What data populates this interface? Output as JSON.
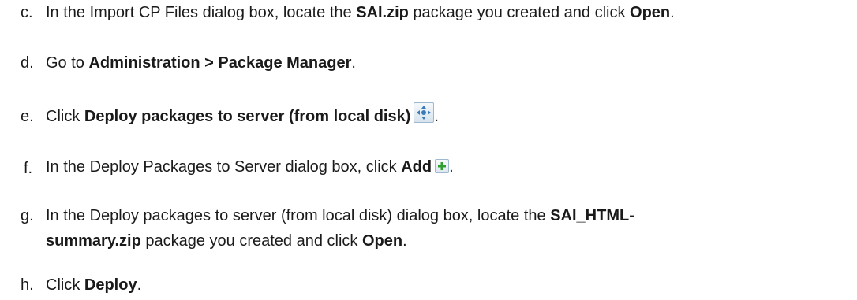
{
  "steps": [
    {
      "marker": "c.",
      "parts": [
        {
          "t": "In the Import CP Files dialog box, locate the ",
          "b": false
        },
        {
          "t": "SAI.zip",
          "b": true
        },
        {
          "t": " package you created and click ",
          "b": false
        },
        {
          "t": "Open",
          "b": true
        },
        {
          "t": ".",
          "b": false
        }
      ]
    },
    {
      "marker": "d.",
      "parts": [
        {
          "t": "Go to ",
          "b": false
        },
        {
          "t": "Administration > Package Manager",
          "b": true
        },
        {
          "t": ".",
          "b": false
        }
      ]
    },
    {
      "marker": "e.",
      "parts": [
        {
          "t": "Click ",
          "b": false
        },
        {
          "t": "Deploy packages to server (from local disk)",
          "b": true
        },
        {
          "t": ".",
          "b": false
        }
      ],
      "icon": "deploy-packages-icon"
    },
    {
      "marker": "f.",
      "parts": [
        {
          "t": "In the Deploy Packages to Server dialog box, click ",
          "b": false
        },
        {
          "t": "Add",
          "b": true
        },
        {
          "t": ".",
          "b": false
        }
      ],
      "icon": "add-icon"
    },
    {
      "marker": "g.",
      "parts": [
        {
          "t": "In the Deploy packages to server (from local disk) dialog box, locate the ",
          "b": false
        },
        {
          "t": "SAI_HTML-",
          "b": true
        }
      ],
      "parts2": [
        {
          "t": "summary.zip",
          "b": true
        },
        {
          "t": " package you created and click ",
          "b": false
        },
        {
          "t": "Open",
          "b": true
        },
        {
          "t": ".",
          "b": false
        }
      ]
    },
    {
      "marker": "h.",
      "parts": [
        {
          "t": "Click ",
          "b": false
        },
        {
          "t": "Deploy",
          "b": true
        },
        {
          "t": ".",
          "b": false
        }
      ]
    }
  ],
  "colors": {
    "text": "#1a1a1a",
    "background": "#ffffff",
    "icon_border": "#9eb8cf",
    "add_plus": "#2e9e2e",
    "deploy_arrows": "#3d7ab8"
  }
}
